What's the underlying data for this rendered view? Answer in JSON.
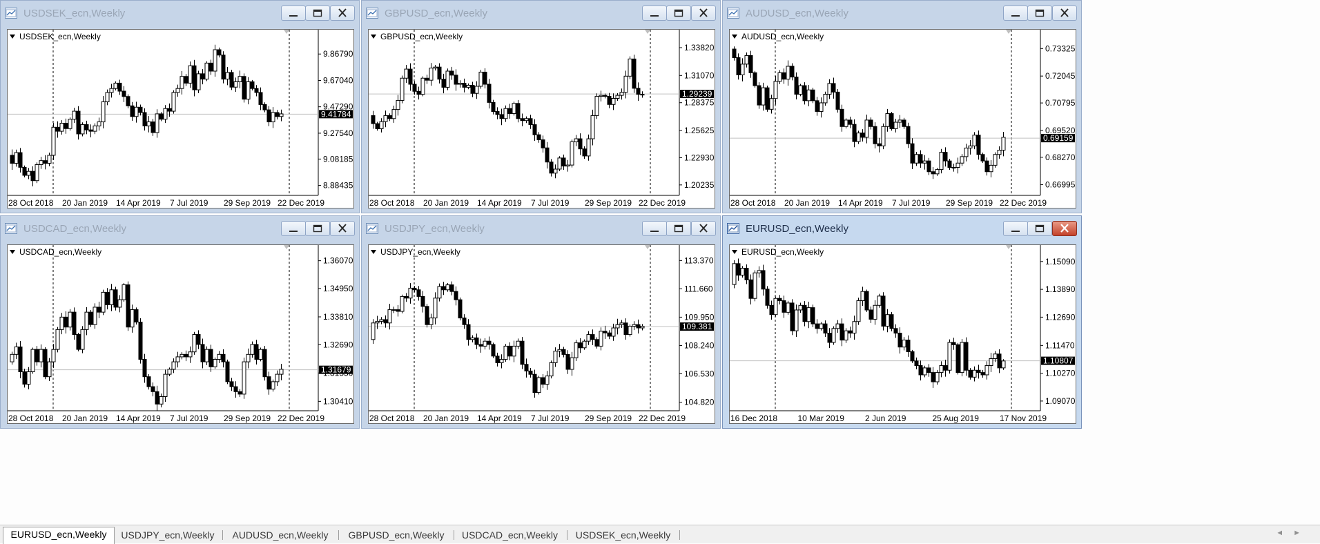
{
  "app": {
    "colors": {
      "frame": "#c6d5e8",
      "chart_bg": "#ffffff",
      "bull": "#ffffff",
      "bear": "#000000",
      "current_price_line": "#c0c0c0",
      "price_tag": "#000000"
    }
  },
  "windows": [
    {
      "title": "USDSEK_ecn,Weekly",
      "label": "USDSEK_ecn,Weekly",
      "active": false,
      "buttons": [
        "minimize-icon",
        "maximize-icon",
        "close-icon"
      ],
      "chart_data": {
        "type": "candlestick",
        "yticks": [
          9.8679,
          9.6704,
          9.4729,
          9.2754,
          9.08185,
          8.88435
        ],
        "ytick_labels": [
          "9.86790",
          "9.67040",
          "9.47290",
          "9.27540",
          "9.08185",
          "8.88435"
        ],
        "ylim": [
          8.81,
          10.05
        ],
        "xtick_labels": [
          "28 Oct 2018",
          "20 Jan 2019",
          "14 Apr 2019",
          "7 Jul 2019",
          "29 Sep 2019",
          "22 Dec 2019"
        ],
        "current_price": 9.41784,
        "current_label": "9.41784",
        "closes": [
          9.12,
          9.08,
          9.02,
          9.1,
          9.06,
          9.14,
          9.09,
          9.11,
          9.05,
          9.13,
          9.02,
          8.96,
          8.99,
          8.92,
          9.04,
          9.07,
          9.05,
          9.11,
          9.32,
          9.29,
          9.35,
          9.31,
          9.38,
          9.44,
          9.27,
          9.34,
          9.3,
          9.29,
          9.33,
          9.36,
          9.51,
          9.58,
          9.61,
          9.65,
          9.59,
          9.55,
          9.48,
          9.4,
          9.47,
          9.43,
          9.33,
          9.36,
          9.28,
          9.42,
          9.38,
          9.46,
          9.44,
          9.58,
          9.61,
          9.7,
          9.65,
          9.78,
          9.6,
          9.72,
          9.68,
          9.8,
          9.74,
          9.9,
          9.86,
          9.68,
          9.73,
          9.62,
          9.66,
          9.7,
          9.53,
          9.66,
          9.61,
          9.58,
          9.49,
          9.45,
          9.36,
          9.43,
          9.4,
          9.42
        ]
      }
    },
    {
      "title": "GBPUSD_ecn,Weekly",
      "label": "GBPUSD_ecn,Weekly",
      "active": false,
      "buttons": [
        "minimize-icon",
        "maximize-icon",
        "close-icon"
      ],
      "chart_data": {
        "type": "candlestick",
        "yticks": [
          1.3382,
          1.3107,
          1.28375,
          1.25625,
          1.2293,
          1.20235
        ],
        "ytick_labels": [
          "1.33820",
          "1.31070",
          "1.28375",
          "1.25625",
          "1.22930",
          "1.20235"
        ],
        "ylim": [
          1.192,
          1.356
        ],
        "xtick_labels": [
          "28 Oct 2018",
          "20 Jan 2019",
          "14 Apr 2019",
          "7 Jul 2019",
          "29 Sep 2019",
          "22 Dec 2019"
        ],
        "current_price": 1.29239,
        "current_label": "1.29239",
        "closes": [
          1.281,
          1.296,
          1.301,
          1.289,
          1.285,
          1.276,
          1.279,
          1.272,
          1.266,
          1.271,
          1.263,
          1.258,
          1.265,
          1.271,
          1.268,
          1.277,
          1.286,
          1.308,
          1.317,
          1.302,
          1.295,
          1.292,
          1.308,
          1.306,
          1.318,
          1.319,
          1.307,
          1.299,
          1.315,
          1.311,
          1.302,
          1.303,
          1.299,
          1.301,
          1.293,
          1.3,
          1.314,
          1.302,
          1.284,
          1.275,
          1.272,
          1.268,
          1.278,
          1.273,
          1.283,
          1.268,
          1.266,
          1.268,
          1.262,
          1.252,
          1.247,
          1.239,
          1.225,
          1.214,
          1.218,
          1.229,
          1.221,
          1.222,
          1.245,
          1.248,
          1.238,
          1.231,
          1.248,
          1.271,
          1.29,
          1.291,
          1.29,
          1.282,
          1.288,
          1.291,
          1.294,
          1.31,
          1.327,
          1.298,
          1.292,
          1.292
        ]
      }
    },
    {
      "title": "AUDUSD_ecn,Weekly",
      "label": "AUDUSD_ecn,Weekly",
      "active": false,
      "buttons": [
        "minimize-icon",
        "maximize-icon",
        "close-icon"
      ],
      "chart_data": {
        "type": "candlestick",
        "yticks": [
          0.73325,
          0.72045,
          0.70795,
          0.6952,
          0.6827,
          0.66995
        ],
        "ytick_labels": [
          "0.73325",
          "0.72045",
          "0.70795",
          "0.69520",
          "0.68270",
          "0.66995"
        ],
        "ylim": [
          0.665,
          0.742
        ],
        "xtick_labels": [
          "28 Oct 2018",
          "20 Jan 2019",
          "14 Apr 2019",
          "7 Jul 2019",
          "29 Sep 2019",
          "22 Dec 2019"
        ],
        "current_price": 0.69159,
        "current_label": "0.69159",
        "closes": [
          0.716,
          0.722,
          0.729,
          0.723,
          0.728,
          0.733,
          0.729,
          0.721,
          0.726,
          0.73,
          0.722,
          0.716,
          0.707,
          0.715,
          0.705,
          0.71,
          0.718,
          0.722,
          0.719,
          0.725,
          0.72,
          0.712,
          0.716,
          0.709,
          0.714,
          0.709,
          0.704,
          0.708,
          0.712,
          0.717,
          0.713,
          0.705,
          0.697,
          0.7,
          0.698,
          0.69,
          0.694,
          0.692,
          0.7,
          0.697,
          0.689,
          0.688,
          0.697,
          0.703,
          0.696,
          0.699,
          0.7,
          0.697,
          0.689,
          0.68,
          0.684,
          0.68,
          0.681,
          0.676,
          0.675,
          0.677,
          0.685,
          0.681,
          0.678,
          0.678,
          0.68,
          0.683,
          0.687,
          0.688,
          0.693,
          0.684,
          0.681,
          0.676,
          0.679,
          0.684,
          0.686,
          0.692
        ]
      }
    },
    {
      "title": "USDCAD_ecn,Weekly",
      "label": "USDCAD_ecn,Weekly",
      "active": false,
      "buttons": [
        "minimize-icon",
        "maximize-icon",
        "close-icon"
      ],
      "chart_data": {
        "type": "candlestick",
        "yticks": [
          1.3607,
          1.3495,
          1.3381,
          1.3269,
          1.3155,
          1.3041
        ],
        "ytick_labels": [
          "1.36070",
          "1.34950",
          "1.33810",
          "1.32690",
          "1.31550",
          "1.30410"
        ],
        "ylim": [
          1.3003,
          1.367
        ],
        "xtick_labels": [
          "28 Oct 2018",
          "20 Jan 2019",
          "14 Apr 2019",
          "7 Jul 2019",
          "29 Sep 2019",
          "22 Dec 2019"
        ],
        "current_price": 1.31679,
        "current_label": "1.31679",
        "closes": [
          1.312,
          1.317,
          1.314,
          1.318,
          1.323,
          1.327,
          1.334,
          1.34,
          1.347,
          1.353,
          1.362,
          1.36,
          1.336,
          1.325,
          1.33,
          1.329,
          1.32,
          1.323,
          1.326,
          1.316,
          1.311,
          1.316,
          1.325,
          1.32,
          1.325,
          1.314,
          1.32,
          1.325,
          1.333,
          1.338,
          1.334,
          1.34,
          1.331,
          1.325,
          1.333,
          1.34,
          1.335,
          1.342,
          1.34,
          1.348,
          1.343,
          1.349,
          1.342,
          1.345,
          1.351,
          1.334,
          1.341,
          1.336,
          1.321,
          1.314,
          1.31,
          1.308,
          1.303,
          1.306,
          1.315,
          1.317,
          1.32,
          1.322,
          1.323,
          1.322,
          1.324,
          1.331,
          1.327,
          1.32,
          1.325,
          1.318,
          1.321,
          1.323,
          1.32,
          1.312,
          1.31,
          1.308,
          1.307,
          1.32,
          1.323,
          1.327,
          1.321,
          1.325,
          1.314,
          1.309,
          1.312,
          1.315,
          1.317
        ]
      }
    },
    {
      "title": "USDJPY_ecn,Weekly",
      "label": "USDJPY_ecn,Weekly",
      "active": false,
      "buttons": [
        "minimize-icon",
        "maximize-icon",
        "close-icon"
      ],
      "chart_data": {
        "type": "candlestick",
        "yticks": [
          113.37,
          111.66,
          109.95,
          108.24,
          106.53,
          104.82
        ],
        "ytick_labels": [
          "113.370",
          "111.660",
          "109.950",
          "108.240",
          "106.530",
          "104.820"
        ],
        "ylim": [
          104.3,
          114.3
        ],
        "xtick_labels": [
          "28 Oct 2018",
          "20 Jan 2019",
          "14 Apr 2019",
          "7 Jul 2019",
          "29 Sep 2019",
          "22 Dec 2019"
        ],
        "current_price": 109.381,
        "current_label": "109.381",
        "closes": [
          112.8,
          113.5,
          113.2,
          113.8,
          113.6,
          112.9,
          112.6,
          113.3,
          111.6,
          110.9,
          110.0,
          108.5,
          108.7,
          108.4,
          108.6,
          109.6,
          109.7,
          109.8,
          109.6,
          110.4,
          110.4,
          110.3,
          111.2,
          111.1,
          111.7,
          111.6,
          111.2,
          110.6,
          109.5,
          109.9,
          111.1,
          111.8,
          111.6,
          111.9,
          111.5,
          111.0,
          109.9,
          109.5,
          108.6,
          108.7,
          108.3,
          108.2,
          108.5,
          108.3,
          107.6,
          107.2,
          107.4,
          108.2,
          107.6,
          108.2,
          108.5,
          107.1,
          106.7,
          106.5,
          105.4,
          106.3,
          105.9,
          106.4,
          107.2,
          107.9,
          108.0,
          107.7,
          106.8,
          107.5,
          108.4,
          108.1,
          108.5,
          108.9,
          108.6,
          108.2,
          109.1,
          109.0,
          108.8,
          109.3,
          109.5,
          109.6,
          108.9,
          109.4,
          109.5,
          109.3,
          109.4
        ]
      }
    },
    {
      "title": "EURUSD_ecn,Weekly",
      "label": "EURUSD_ecn,Weekly",
      "active": true,
      "buttons": [
        "minimize-icon",
        "maximize-icon",
        "close-icon"
      ],
      "chart_data": {
        "type": "candlestick",
        "yticks": [
          1.1509,
          1.1389,
          1.1269,
          1.1147,
          1.1027,
          1.0907
        ],
        "ytick_labels": [
          "1.15090",
          "1.13890",
          "1.12690",
          "1.11470",
          "1.10270",
          "1.09070"
        ],
        "ylim": [
          1.0865,
          1.158
        ],
        "xtick_labels": [
          "16 Dec 2018",
          "10 Mar 2019",
          "2 Jun 2019",
          "25 Aug 2019",
          "17 Nov 2019"
        ],
        "current_price": 1.10807,
        "current_label": "1.10807",
        "closes": [
          1.141,
          1.15,
          1.145,
          1.148,
          1.143,
          1.135,
          1.146,
          1.147,
          1.139,
          1.132,
          1.128,
          1.135,
          1.134,
          1.129,
          1.133,
          1.121,
          1.13,
          1.132,
          1.125,
          1.131,
          1.124,
          1.122,
          1.124,
          1.12,
          1.116,
          1.122,
          1.124,
          1.117,
          1.121,
          1.12,
          1.125,
          1.134,
          1.138,
          1.13,
          1.126,
          1.132,
          1.136,
          1.123,
          1.128,
          1.122,
          1.12,
          1.114,
          1.117,
          1.112,
          1.108,
          1.106,
          1.102,
          1.105,
          1.103,
          1.099,
          1.103,
          1.106,
          1.104,
          1.116,
          1.115,
          1.103,
          1.116,
          1.104,
          1.101,
          1.104,
          1.103,
          1.102,
          1.106,
          1.109,
          1.111,
          1.105,
          1.108
        ]
      }
    }
  ],
  "tabs": [
    "EURUSD_ecn,Weekly",
    "USDJPY_ecn,Weekly",
    "AUDUSD_ecn,Weekly",
    "GBPUSD_ecn,Weekly",
    "USDCAD_ecn,Weekly",
    "USDSEK_ecn,Weekly"
  ],
  "active_tab": 0,
  "tab_scroll": {
    "left": "◄",
    "right": "►"
  }
}
